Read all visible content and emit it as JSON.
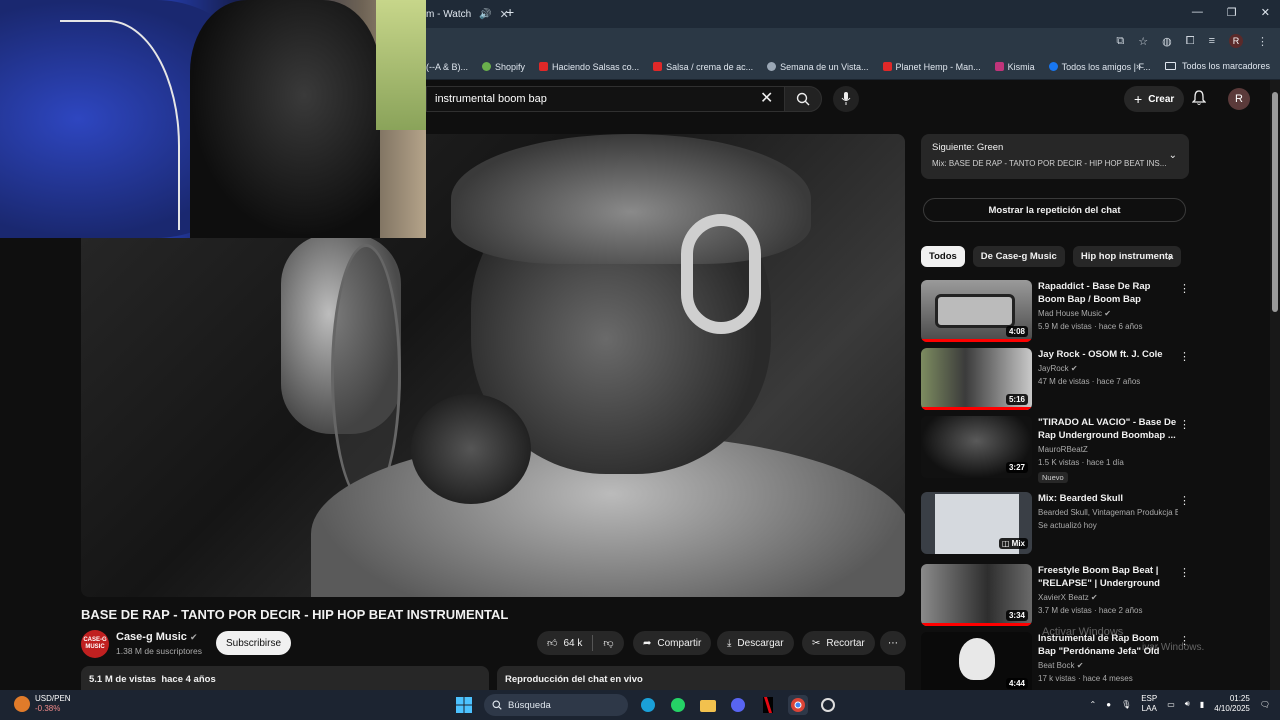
{
  "browser": {
    "tab_title": "m - Watch",
    "bookmarks": [
      {
        "label": "(--A & B)...",
        "icon": "bookmark-icon"
      },
      {
        "label": "Shopify",
        "icon": "shopify-icon"
      },
      {
        "label": "Haciendo Salsas co...",
        "icon": "youtube-icon"
      },
      {
        "label": "Salsa / crema de ac...",
        "icon": "youtube-icon"
      },
      {
        "label": "Semana de un Vista...",
        "icon": "globe-icon"
      },
      {
        "label": "Planet Hemp - Man...",
        "icon": "youtube-icon"
      },
      {
        "label": "Kismia",
        "icon": "kismia-icon"
      },
      {
        "label": "Todos los amigos | F...",
        "icon": "facebook-icon"
      }
    ],
    "all_bookmarks_label": "Todos los marcadores",
    "profile_initial": "R"
  },
  "header": {
    "search_value": "instrumental boom bap",
    "create_label": "Crear",
    "account_initial": "R"
  },
  "video": {
    "title": "BASE DE RAP - TANTO POR DECIR - HIP HOP BEAT INSTRUMENTAL",
    "channel_name": "Case-g Music",
    "channel_avatar_text": "CASE-G MUSIC",
    "subscribers": "1.38 M de suscriptores",
    "subscribe_label": "Subscribirse",
    "likes": "64 k",
    "share_label": "Compartir",
    "download_label": "Descargar",
    "clip_label": "Recortar",
    "views_date": "5.1 M de vistas  hace 4 años",
    "live_chat_label": "Reproducción del chat en vivo"
  },
  "sidebar": {
    "up_next_label": "Siguiente: Green",
    "up_next_sub": "Mix: BASE DE RAP - TANTO POR DECIR - HIP HOP BEAT INS...",
    "show_chat_label": "Mostrar la repetición del chat",
    "chips": [
      "Todos",
      "De Case-g Music",
      "Hip hop instrumenta"
    ],
    "recommendations": [
      {
        "title": "Rapaddict - Base De Rap Boom Bap / Boom Bap Instrumental",
        "channel": "Mad House Music",
        "meta": "5.9 M de vistas · hace 6 años",
        "duration": "4:08",
        "badge": "",
        "thumb_color": "#8a8a8a"
      },
      {
        "title": "Jay Rock - OSOM ft. J. Cole",
        "channel": "JayRock",
        "meta": "47 M de vistas · hace 7 años",
        "duration": "5:16",
        "badge": "",
        "thumb_color": "#5c6b4a"
      },
      {
        "title": "\"TIRADO AL VACIO\" - Base De Rap Underground Boombap ...",
        "channel": "MauroRBeatZ",
        "meta": "1.5 K vistas · hace 1 día",
        "duration": "3:27",
        "badge": "Nuevo",
        "thumb_color": "#2a2a2a"
      },
      {
        "title": "Mix: Bearded Skull",
        "channel": "Bearded Skull, Vintageman Produkcja Be...",
        "meta": "Se actualizó hoy",
        "duration": "Mix",
        "badge": "",
        "thumb_color": "#cfd3d8"
      },
      {
        "title": "Freestyle Boom Bap Beat | \"RELAPSE\" | Underground Boo...",
        "channel": "XavierX Beatz",
        "meta": "3.7 M de vistas · hace 2 años",
        "duration": "3:34",
        "badge": "",
        "thumb_color": "#6b6b6b"
      },
      {
        "title": "Instrumental de Rap Boom Bap \"Perdóname Jefa\" Old School ...",
        "channel": "Beat Bock",
        "meta": "17 k vistas · hace 4 meses",
        "duration": "4:44",
        "badge": "",
        "thumb_color": "#111111"
      }
    ]
  },
  "watermark": {
    "line1": "Activar Windows",
    "line2": "ivar Windows."
  },
  "taskbar": {
    "ticker_name": "USD/PEN",
    "ticker_change": "-0.38%",
    "search_label": "Búsqueda",
    "lang_top": "ESP",
    "lang_bottom": "LAA",
    "time": "01:25",
    "date": "4/10/2025"
  }
}
